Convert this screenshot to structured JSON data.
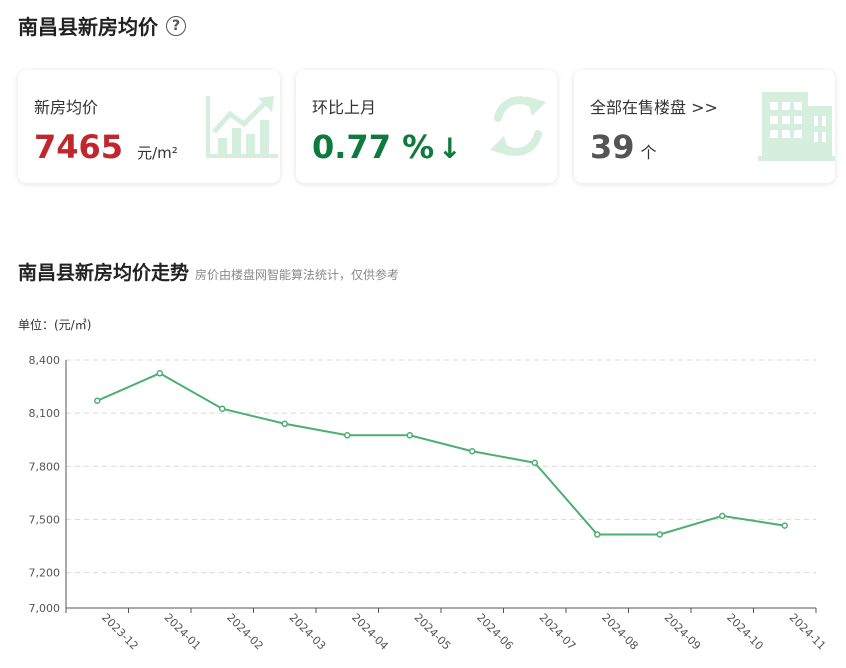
{
  "header": {
    "title": "南昌县新房均价",
    "help_symbol": "?"
  },
  "cards": {
    "avg_price": {
      "label": "新房均价",
      "value": "7465",
      "unit": "元/m²",
      "color": "#c0272d",
      "icon": "chart-growth-icon"
    },
    "mom": {
      "label": "环比上月",
      "value": "0.77 %",
      "arrow": "↓",
      "color": "#0f7a3d",
      "icon": "refresh-cycle-icon"
    },
    "listings": {
      "label": "全部在售楼盘 >>",
      "value": "39",
      "unit": "个",
      "color": "#555555",
      "icon": "building-icon"
    }
  },
  "section": {
    "title": "南昌县新房均价走势",
    "subtitle": "房价由楼盘网智能算法统计，仅供参考"
  },
  "chart_unit_label": "单位：(元/㎡)",
  "colors": {
    "line": "#4caf72",
    "icon_tint": "#d6eedd"
  },
  "chart_data": {
    "type": "line",
    "categories": [
      "2023-12",
      "2024-01",
      "2024-02",
      "2024-03",
      "2024-04",
      "2024-05",
      "2024-06",
      "2024-07",
      "2024-08",
      "2024-09",
      "2024-10",
      "2024-11"
    ],
    "series": [
      {
        "values": [
          8170,
          8325,
          8125,
          8040,
          7975,
          7975,
          7885,
          7820,
          7415,
          7415,
          7520,
          7465
        ]
      }
    ],
    "ylim": [
      7000,
      8400
    ],
    "yticks": [
      7000,
      7200,
      7500,
      7800,
      8100,
      8400
    ],
    "ytick_labels": [
      "7,000",
      "7,200",
      "7,500",
      "7,800",
      "8,100",
      "8,400"
    ],
    "grid": true,
    "ylabel": "单位：(元/㎡)"
  }
}
